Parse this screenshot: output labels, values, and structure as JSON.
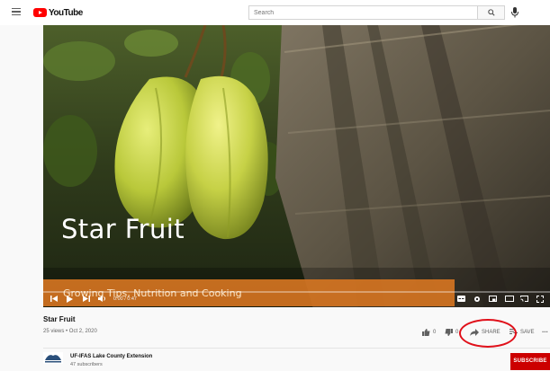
{
  "header": {
    "logo_text": "YouTube",
    "search_placeholder": "Search"
  },
  "video": {
    "overlay_title": "Star Fruit",
    "overlay_subtitle": "Growing Tips, Nutrition and Cooking",
    "time": "0:00 / 0:47",
    "progress": 0.0,
    "title": "Star Fruit",
    "stats": "25 views • Oct 2, 2020"
  },
  "actions": {
    "like_count": "0",
    "dislike_count": "0",
    "share_label": "SHARE",
    "save_label": "SAVE",
    "more_label": "..."
  },
  "channel": {
    "name": "UF-IFAS Lake County Extension",
    "subscribers": "47 subscribers",
    "subscribe_label": "SUBSCRIBE"
  },
  "colors": {
    "brand": "#ff0000",
    "subtitle_band": "#d77621",
    "annotation": "#e0101a"
  }
}
